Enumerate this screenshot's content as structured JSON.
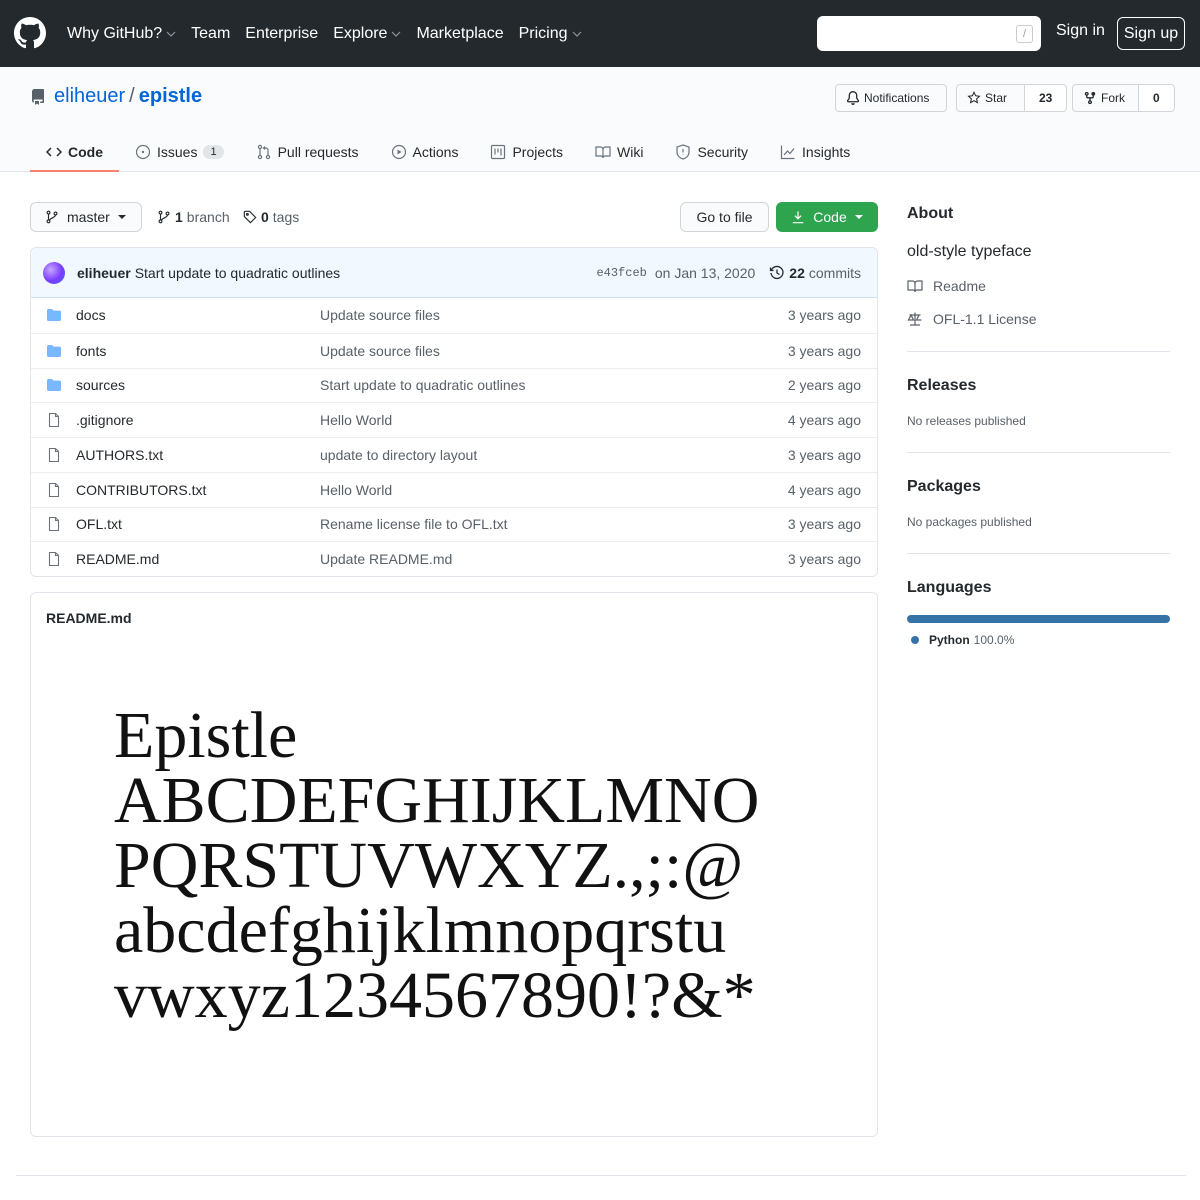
{
  "header": {
    "nav": [
      {
        "label": "Why GitHub?",
        "dropdown": true
      },
      {
        "label": "Team",
        "dropdown": false
      },
      {
        "label": "Enterprise",
        "dropdown": false
      },
      {
        "label": "Explore",
        "dropdown": true
      },
      {
        "label": "Marketplace",
        "dropdown": false
      },
      {
        "label": "Pricing",
        "dropdown": true
      }
    ],
    "search_key_hint": "/",
    "signin": "Sign in",
    "signup": "Sign up"
  },
  "repo": {
    "owner": "eliheuer",
    "separator": "/",
    "name": "epistle",
    "notifications_label": "Notifications",
    "star_label": "Star",
    "star_count": "23",
    "fork_label": "Fork",
    "fork_count": "0"
  },
  "tabs": [
    {
      "label": "Code",
      "icon": "code-icon",
      "selected": true
    },
    {
      "label": "Issues",
      "icon": "issue-icon",
      "counter": "1"
    },
    {
      "label": "Pull requests",
      "icon": "pull-request-icon"
    },
    {
      "label": "Actions",
      "icon": "play-icon"
    },
    {
      "label": "Projects",
      "icon": "project-icon"
    },
    {
      "label": "Wiki",
      "icon": "book-icon"
    },
    {
      "label": "Security",
      "icon": "shield-icon"
    },
    {
      "label": "Insights",
      "icon": "graph-icon"
    }
  ],
  "branchbar": {
    "branch": "master",
    "branch_count": "1",
    "branch_word": "branch",
    "tag_count": "0",
    "tag_word": "tags",
    "go_to_file": "Go to file",
    "code_button": "Code"
  },
  "commit": {
    "author": "eliheuer",
    "message": "Start update to quadratic outlines",
    "sha": "e43fceb",
    "date": "on Jan 13, 2020",
    "commit_count": "22",
    "commit_word": "commits"
  },
  "files": [
    {
      "name": "docs",
      "type": "dir",
      "message": "Update source files",
      "age": "3 years ago"
    },
    {
      "name": "fonts",
      "type": "dir",
      "message": "Update source files",
      "age": "3 years ago"
    },
    {
      "name": "sources",
      "type": "dir",
      "message": "Start update to quadratic outlines",
      "age": "2 years ago"
    },
    {
      "name": ".gitignore",
      "type": "file",
      "message": "Hello World",
      "age": "4 years ago"
    },
    {
      "name": "AUTHORS.txt",
      "type": "file",
      "message": "update to directory layout",
      "age": "3 years ago"
    },
    {
      "name": "CONTRIBUTORS.txt",
      "type": "file",
      "message": "Hello World",
      "age": "4 years ago"
    },
    {
      "name": "OFL.txt",
      "type": "file",
      "message": "Rename license file to OFL.txt",
      "age": "3 years ago"
    },
    {
      "name": "README.md",
      "type": "file",
      "message": "Update README.md",
      "age": "3 years ago"
    }
  ],
  "readme": {
    "title": "README.md",
    "specimen_lines": [
      "Epistle",
      "ABCDEFGHIJKLMNO",
      "PQRSTUVWXYZ.,;:@",
      "abcdefghijklmnopqrstu",
      "vwxyz1234567890!?&*"
    ]
  },
  "sidebar": {
    "about_heading": "About",
    "description": "old-style typeface",
    "readme_link": "Readme",
    "license_link": "OFL-1.1 License",
    "releases_heading": "Releases",
    "releases_text": "No releases published",
    "packages_heading": "Packages",
    "packages_text": "No packages published",
    "languages_heading": "Languages",
    "languages": [
      {
        "name": "Python",
        "percent": "100.0%",
        "fraction": 1.0,
        "color": "#3572a5"
      }
    ]
  },
  "colors": {
    "header_bg": "#24292e",
    "link": "#0366d6",
    "primary_button": "#2ea44f",
    "tab_underline": "#f9826c",
    "commit_bar_bg": "#f1f8ff"
  }
}
